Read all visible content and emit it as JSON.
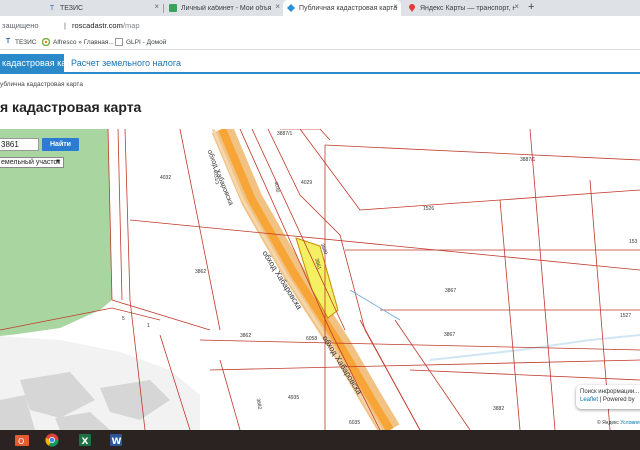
{
  "browser": {
    "tabs": [
      {
        "label": "ТЕЗИС",
        "icon": "tezis-icon",
        "active": false
      },
      {
        "label": "Личный кабинет - Мои объявл...",
        "icon": "cabinet-icon",
        "active": false
      },
      {
        "label": "Публичная кадастровая карта",
        "icon": "cadastre-icon",
        "active": true
      },
      {
        "label": "Яндекс Карты — транспорт, нав...",
        "icon": "map-pin-icon",
        "active": false
      }
    ],
    "new_tab": "+",
    "security_text": "защищено",
    "url_host": "roscadastr.com",
    "url_path": "/map",
    "bookmarks": [
      {
        "label": "ТЕЗИС",
        "icon": "tezis-icon"
      },
      {
        "label": "Alfresco » Главная...",
        "icon": "alfresco-icon"
      },
      {
        "label": "GLPI - Домой",
        "icon": "glpi-icon"
      }
    ]
  },
  "site": {
    "nav_active": "кадастровая карта",
    "nav_link": "Расчет земельного налога",
    "breadcrumb": "ублична кадастровая карта",
    "title": "я кадастровая карта"
  },
  "map": {
    "search_value": "3861",
    "search_button": "Найти",
    "type_select": "емельный участок",
    "road_labels": [
      "обход Хабаровска",
      "обход Хабаровска",
      "обход Хабаровска"
    ],
    "parcel_labels": [
      "3887/1",
      "3887/1",
      "4032",
      "4029",
      "1526",
      "3862",
      "3867",
      "3862",
      "3867",
      "1527",
      "4935",
      "3882",
      "3882",
      "6058",
      "5",
      "1",
      "3861",
      "3880",
      "153",
      "6035",
      "4031/1",
      "4030"
    ],
    "popup_line1": "Поиск информации...",
    "popup_link": "Leaflet",
    "popup_line2": "| Powered by",
    "attribution_prefix": "© Яндекс",
    "attribution_link": "Условия"
  },
  "taskbar": {
    "apps": [
      "windows-icon",
      "chrome-icon",
      "excel-icon",
      "word-icon"
    ]
  }
}
